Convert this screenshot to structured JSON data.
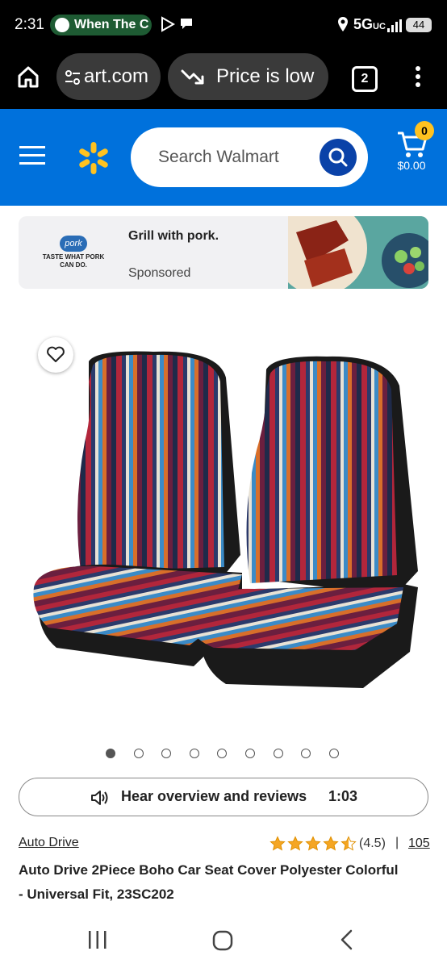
{
  "status_bar": {
    "time": "2:31",
    "media_text": "When The C",
    "network": "5G",
    "network_sub": "UC",
    "battery": "44"
  },
  "browser": {
    "url_text": "art.com",
    "price_chip": "Price is low",
    "tab_count": "2"
  },
  "header": {
    "search_placeholder": "Search Walmart",
    "cart_count": "0",
    "cart_total": "$0.00",
    "brand_color": "#0071dc",
    "accent_color": "#ffc220"
  },
  "ad": {
    "logo_text": "pork",
    "logo_tagline": "TASTE WHAT PORK CAN DO.",
    "title": "Grill with pork.",
    "label": "Sponsored"
  },
  "product": {
    "image_count": 9,
    "active_image": 0,
    "audio_label": "Hear overview and reviews",
    "audio_duration": "1:03",
    "brand": "Auto Drive",
    "rating_value": 4.5,
    "rating_text": "(4.5)",
    "separator": "|",
    "review_count": "105",
    "title": "Auto Drive 2Piece Boho Car Seat Cover Polyester Colorful - Universal Fit, 23SC202"
  },
  "icons": [
    "home-icon",
    "tune-icon",
    "trend-down-icon",
    "more-icon",
    "menu-icon",
    "walmart-spark-icon",
    "search-icon",
    "cart-icon",
    "heart-icon",
    "speaker-icon",
    "star-icon",
    "recents-icon",
    "home-nav-icon",
    "back-icon"
  ]
}
